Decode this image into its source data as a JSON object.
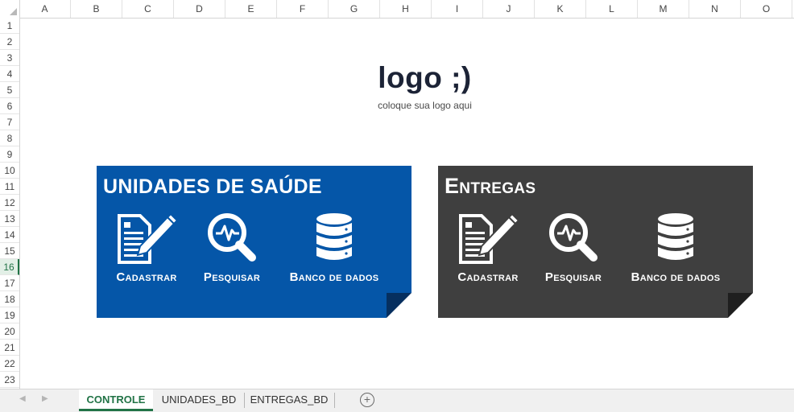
{
  "columns": [
    "A",
    "B",
    "C",
    "D",
    "E",
    "F",
    "G",
    "H",
    "I",
    "J",
    "K",
    "L",
    "M",
    "N",
    "O"
  ],
  "rows": [
    "1",
    "2",
    "3",
    "4",
    "5",
    "6",
    "7",
    "8",
    "9",
    "10",
    "11",
    "12",
    "13",
    "14",
    "15",
    "16",
    "17",
    "18",
    "19",
    "20",
    "21",
    "22",
    "23"
  ],
  "selected_row": "16",
  "logo": {
    "main": "logo ;)",
    "sub": "coloque sua logo aqui"
  },
  "panels": [
    {
      "title": "UNIDADES DE SAÚDE",
      "color": "#0556a8",
      "actions": [
        {
          "label": "Cadastrar",
          "icon": "register-form-icon"
        },
        {
          "label": "Pesquisar",
          "icon": "search-analytics-icon"
        },
        {
          "label": "Banco de dados",
          "icon": "database-icon"
        }
      ]
    },
    {
      "title": "Entregas",
      "color": "#3f3f3f",
      "actions": [
        {
          "label": "Cadastrar",
          "icon": "register-form-icon"
        },
        {
          "label": "Pesquisar",
          "icon": "search-analytics-icon"
        },
        {
          "label": "Banco de dados",
          "icon": "database-icon"
        }
      ]
    }
  ],
  "sheets": [
    {
      "label": "CONTROLE",
      "active": true
    },
    {
      "label": "UNIDADES_BD",
      "active": false
    },
    {
      "label": "ENTREGAS_BD",
      "active": false
    }
  ],
  "add_sheet_symbol": "+",
  "accent_color": "#217346"
}
